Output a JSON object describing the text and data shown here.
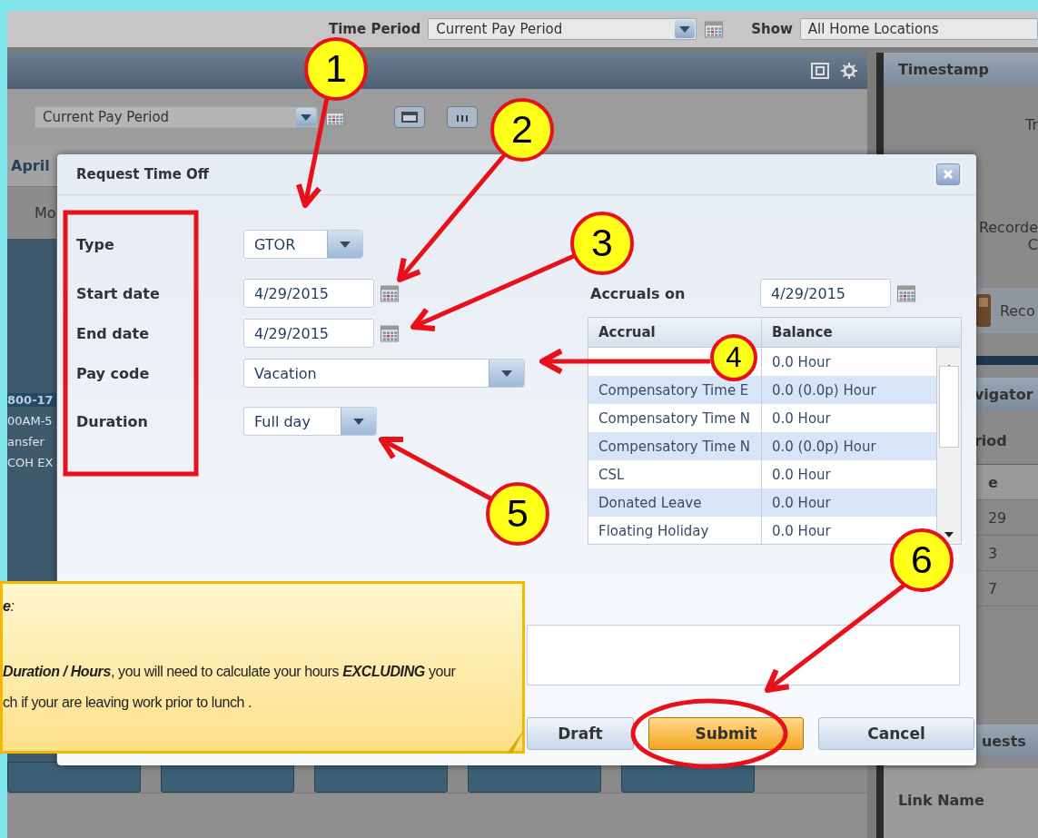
{
  "top_bar": {
    "time_period_label": "Time Period",
    "time_period": "Current Pay Period",
    "show_label": "Show",
    "show": "All Home Locations"
  },
  "timecard": {
    "period": "Current Pay Period",
    "month": "April",
    "day_header": "Mo",
    "schedule_lines": [
      "800-17",
      "00AM-5",
      "ansfer",
      "COH EX"
    ]
  },
  "right_panel": {
    "timestamp_title": "Timestamp",
    "lines": [
      "Tr",
      "Recorde",
      "C"
    ],
    "record_button": "Reco",
    "navigator_title": "vigator",
    "period_label": "riod",
    "column_header": "e",
    "rows": [
      "29",
      "3",
      "7"
    ],
    "requests_title": "uests",
    "link_column": "Link Name"
  },
  "dialog": {
    "title": "Request Time Off",
    "fields": [
      {
        "label": "Type",
        "value": "GTOR",
        "kind": "select"
      },
      {
        "label": "Start date",
        "value": "4/29/2015",
        "kind": "date"
      },
      {
        "label": "End date",
        "value": "4/29/2015",
        "kind": "date"
      },
      {
        "label": "Pay code",
        "value": "Vacation",
        "kind": "select"
      },
      {
        "label": "Duration",
        "value": "Full day",
        "kind": "select"
      }
    ],
    "accruals_label": "Accruals on",
    "accruals_date": "4/29/2015",
    "accrual_columns": [
      "Accrual",
      "Balance"
    ],
    "accruals": [
      {
        "balance": "0.0 Hour"
      },
      {
        "accrual": "Compensatory Time E",
        "balance": "0.0 (0.0p) Hour"
      },
      {
        "accrual": "Compensatory Time N",
        "balance": "0.0 Hour"
      },
      {
        "accrual": "Compensatory Time N",
        "balance": "0.0 (0.0p) Hour"
      },
      {
        "accrual": "CSL",
        "balance": "0.0 Hour"
      },
      {
        "accrual": "Donated Leave",
        "balance": "0.0 Hour"
      },
      {
        "accrual": "Floating Holiday",
        "balance": "0.0 Hour"
      }
    ],
    "buttons": [
      {
        "label": "Draft",
        "primary": false
      },
      {
        "label": "Submit",
        "primary": true
      },
      {
        "label": "Cancel",
        "primary": false
      }
    ]
  },
  "note": {
    "heading": "**e**:",
    "lines": [
      "**Duration / Hours**, you will need to calculate your hours **EXCLUDING** your",
      "ch if your are leaving work prior to lunch ."
    ]
  },
  "callouts": [
    {
      "number": "1"
    },
    {
      "number": "2"
    },
    {
      "number": "3"
    },
    {
      "number": "4"
    },
    {
      "number": "5"
    },
    {
      "number": "6"
    }
  ]
}
